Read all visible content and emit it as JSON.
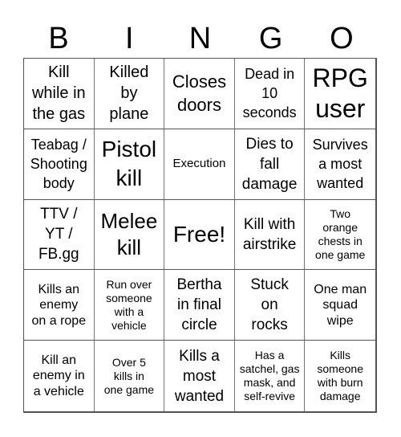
{
  "header": {
    "letters": [
      "B",
      "I",
      "N",
      "G",
      "O"
    ]
  },
  "board": {
    "rows": [
      [
        {
          "text": "Kill\nwhile in\nthe gas",
          "size": "fs-20"
        },
        {
          "text": "Killed\nby\nplane",
          "size": "fs-20"
        },
        {
          "text": "Closes\ndoors",
          "size": "fs-22"
        },
        {
          "text": "Dead in\n10\nseconds",
          "size": "fs-18"
        },
        {
          "text": "RPG\nuser",
          "size": "fs-32"
        }
      ],
      [
        {
          "text": "Teabag /\nShooting\nbody",
          "size": "fs-18"
        },
        {
          "text": "Pistol\nkill",
          "size": "fs-28"
        },
        {
          "text": "Execution",
          "size": "fs-15"
        },
        {
          "text": "Dies to\nfall\ndamage",
          "size": "fs-19"
        },
        {
          "text": "Survives\na most\nwanted",
          "size": "fs-18"
        }
      ],
      [
        {
          "text": "TTV /\nYT /\nFB.gg",
          "size": "fs-19"
        },
        {
          "text": "Melee\nkill",
          "size": "fs-26"
        },
        {
          "text": "Free!",
          "size": "fs-28"
        },
        {
          "text": "Kill with\nairstrike",
          "size": "fs-19"
        },
        {
          "text": "Two\norange\nchests in\none game",
          "size": "fs-14"
        }
      ],
      [
        {
          "text": "Kills an\nenemy\non a rope",
          "size": "fs-16"
        },
        {
          "text": "Run over\nsomeone\nwith a\nvehicle",
          "size": "fs-14"
        },
        {
          "text": "Bertha\nin final\ncircle",
          "size": "fs-19"
        },
        {
          "text": "Stuck\non\nrocks",
          "size": "fs-19"
        },
        {
          "text": "One man\nsquad\nwipe",
          "size": "fs-16"
        }
      ],
      [
        {
          "text": "Kill an\nenemy in\na vehicle",
          "size": "fs-16"
        },
        {
          "text": "Over 5\nkills in\none game",
          "size": "fs-14"
        },
        {
          "text": "Kills a\nmost\nwanted",
          "size": "fs-19"
        },
        {
          "text": "Has a\nsatchel, gas\nmask, and\nself-revive",
          "size": "fs-14"
        },
        {
          "text": "Kills\nsomeone\nwith burn\ndamage",
          "size": "fs-14"
        }
      ]
    ]
  }
}
